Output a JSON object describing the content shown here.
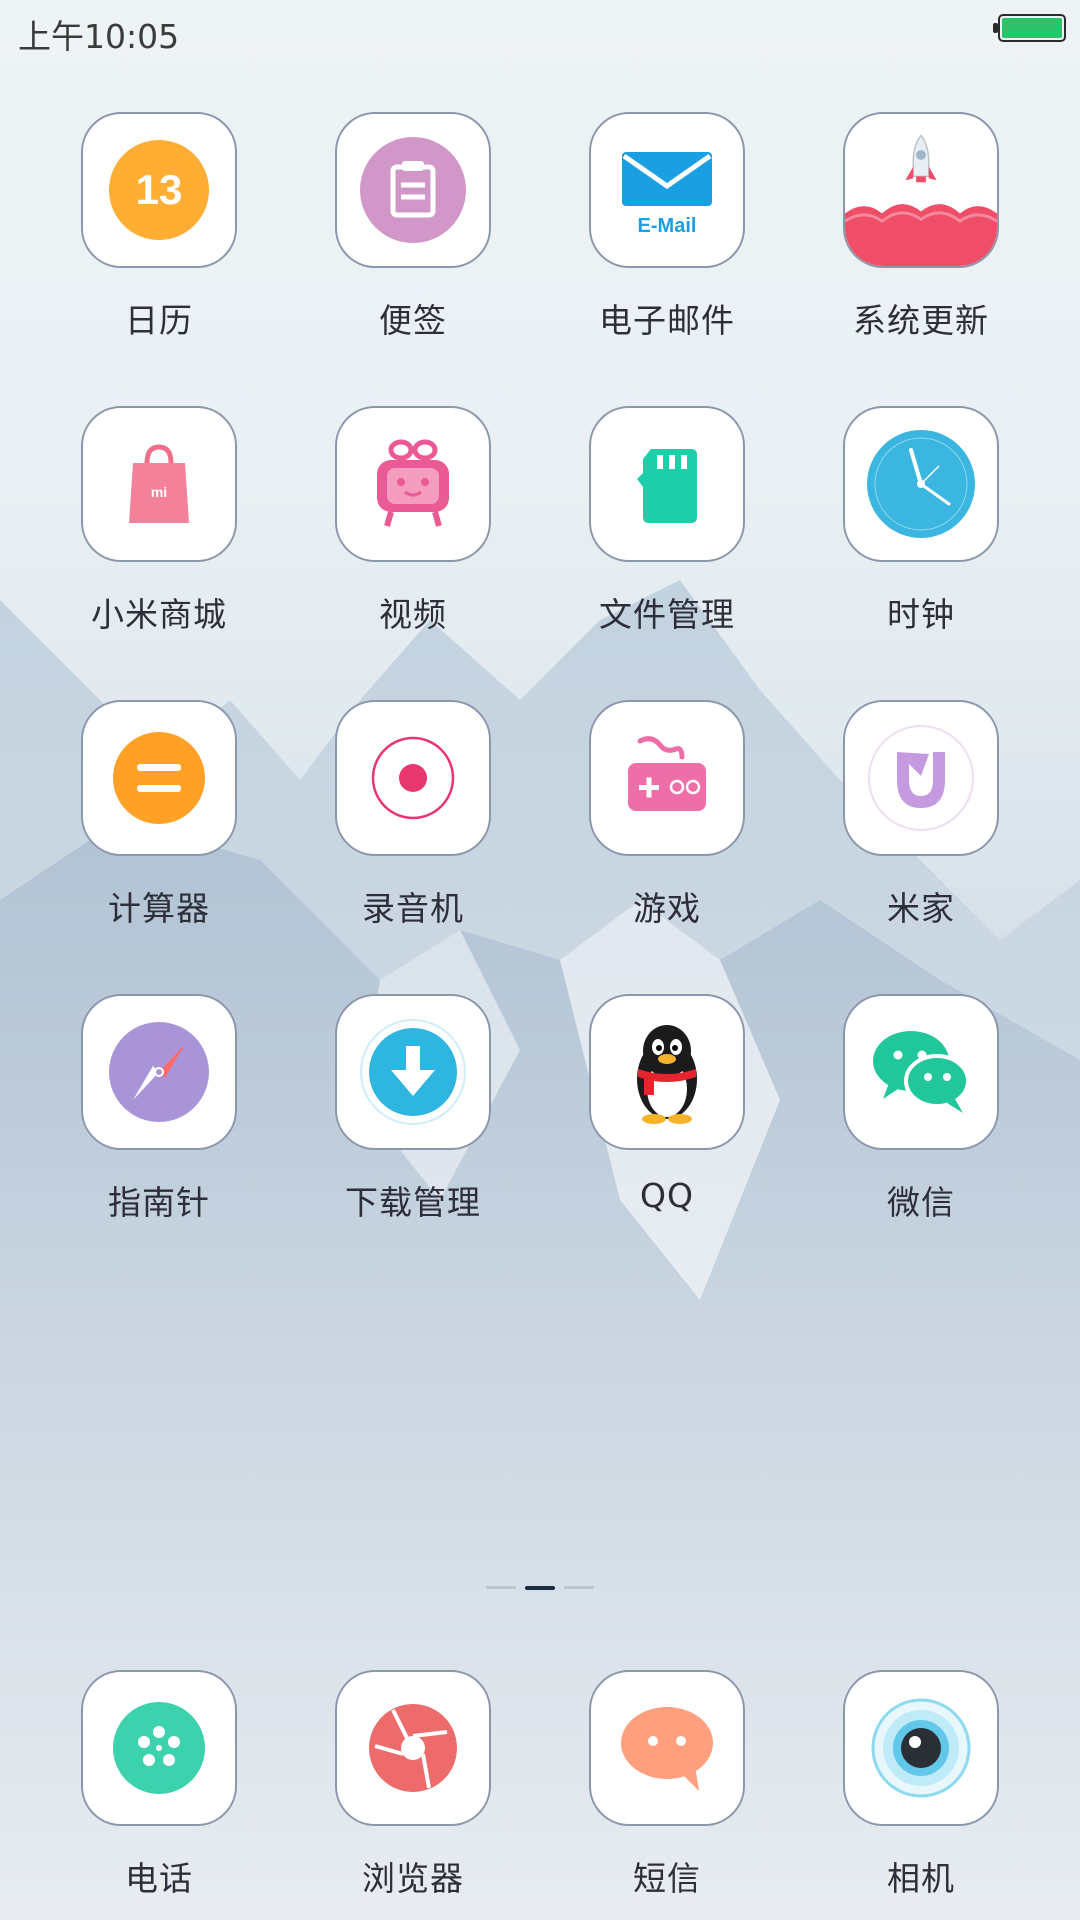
{
  "status_bar": {
    "time": "上午10:05",
    "battery_color": "#29c46b"
  },
  "apps": [
    {
      "label": "日历",
      "icon": "calendar-icon",
      "badge": "13"
    },
    {
      "label": "便签",
      "icon": "notes-icon"
    },
    {
      "label": "电子邮件",
      "icon": "email-icon",
      "icon_text": "E-Mail"
    },
    {
      "label": "系统更新",
      "icon": "rocket-icon"
    },
    {
      "label": "小米商城",
      "icon": "shopping-bag-icon",
      "icon_text": "mi"
    },
    {
      "label": "视频",
      "icon": "tv-icon"
    },
    {
      "label": "文件管理",
      "icon": "sd-card-icon"
    },
    {
      "label": "时钟",
      "icon": "clock-icon"
    },
    {
      "label": "计算器",
      "icon": "calculator-icon"
    },
    {
      "label": "录音机",
      "icon": "record-icon"
    },
    {
      "label": "游戏",
      "icon": "gamepad-icon"
    },
    {
      "label": "米家",
      "icon": "mijia-icon"
    },
    {
      "label": "指南针",
      "icon": "compass-icon"
    },
    {
      "label": "下载管理",
      "icon": "download-icon"
    },
    {
      "label": "QQ",
      "icon": "penguin-icon"
    },
    {
      "label": "微信",
      "icon": "wechat-icon"
    }
  ],
  "dock": [
    {
      "label": "电话",
      "icon": "phone-icon"
    },
    {
      "label": "浏览器",
      "icon": "browser-icon"
    },
    {
      "label": "短信",
      "icon": "message-icon"
    },
    {
      "label": "相机",
      "icon": "camera-icon"
    }
  ],
  "page_indicator": {
    "pages": 3,
    "active": 2
  }
}
